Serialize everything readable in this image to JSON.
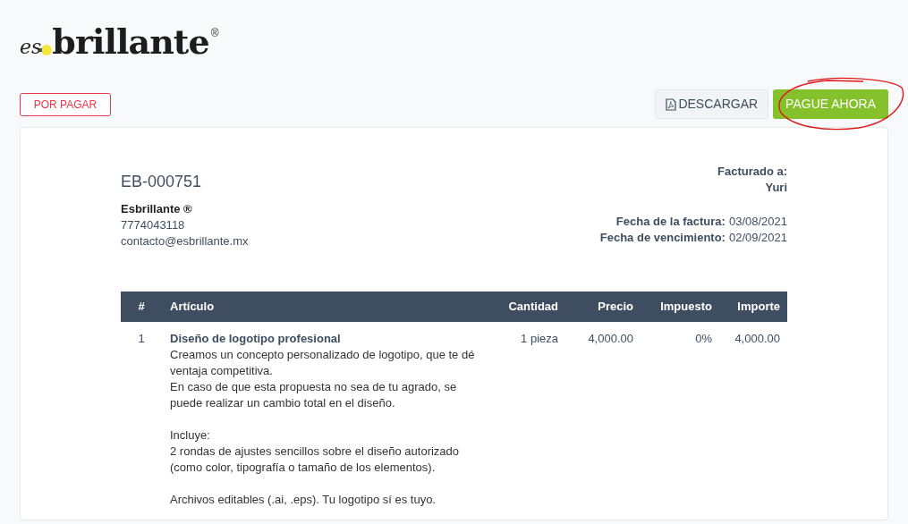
{
  "logo": {
    "prefix": "es",
    "word": "brillante",
    "mark": "®"
  },
  "status_badge": "POR PAGAR",
  "actions": [
    {
      "label": "DESCARGAR",
      "kind": "download"
    },
    {
      "label": "PAGUE AHORA",
      "kind": "primary"
    }
  ],
  "invoice": {
    "number": "EB-000751",
    "company": "Esbrillante ®",
    "phone": "7774043118",
    "email": "contacto@esbrillante.mx",
    "billed_to_label": "Facturado a:",
    "billed_to": "Yuri",
    "dates": [
      {
        "label": "Fecha de la factura:",
        "value": "03/08/2021"
      },
      {
        "label": "Fecha de vencimiento:",
        "value": "02/09/2021"
      }
    ]
  },
  "table": {
    "columns": [
      "#",
      "Artículo",
      "Cantidad",
      "Precio",
      "Impuesto",
      "Importe"
    ],
    "rows": [
      {
        "number": "1",
        "title": "Diseño de logotipo profesional",
        "paragraphs": [
          [
            "Creamos un concepto personalizado de logotipo, que te dé",
            "ventaja competitiva.",
            "En caso de que esta propuesta no sea de tu agrado, se",
            "puede realizar un cambio total en el diseño."
          ],
          [
            "Incluye:",
            "2 rondas de ajustes sencillos sobre el diseño autorizado",
            "(como color, tipografía o tamaño de los elementos)."
          ],
          [
            "Archivos editables (.ai, .eps). Tu logotipo sí es tuyo."
          ]
        ],
        "quantity": "1 pieza",
        "price": "4,000.00",
        "tax": "0%",
        "amount": "4,000.00"
      }
    ]
  }
}
